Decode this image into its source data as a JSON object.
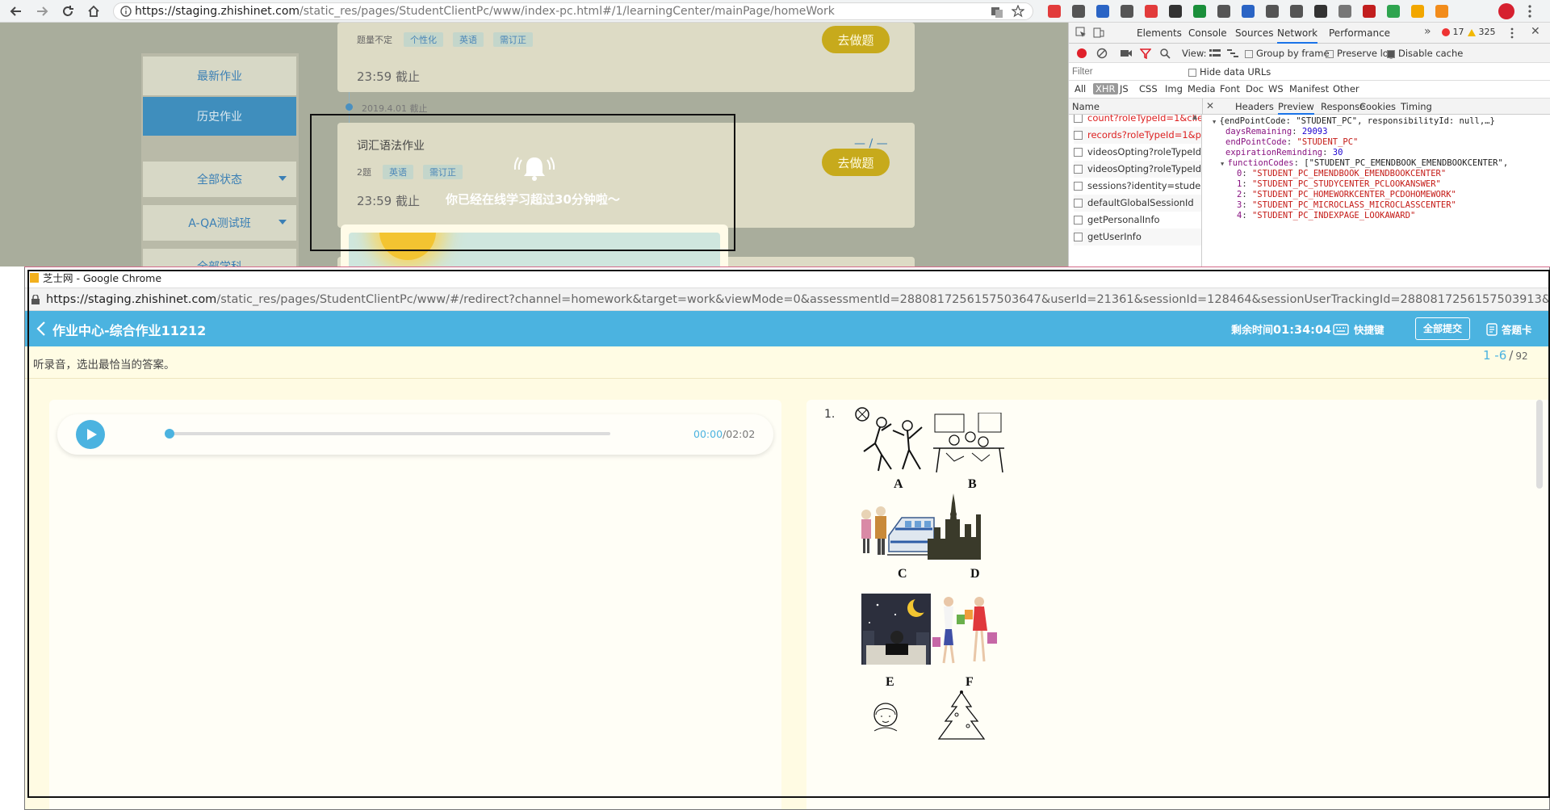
{
  "browser": {
    "url_base": "https://staging.zhishinet.com",
    "url_path": "/static_res/pages/StudentClientPc/www/index-pc.html#/1/learningCenter/mainPage/homeWork"
  },
  "bg_page": {
    "menu": {
      "latest": "最新作业",
      "history": "历史作业",
      "all_status": "全部状态",
      "class": "A-QA测试班",
      "all_subject": "全部学科"
    },
    "card1": {
      "count": "题量不定",
      "tags": [
        "个性化",
        "英语",
        "需订正"
      ],
      "deadline": "23:59 截止",
      "go_button": "去做题"
    },
    "date_label": "2019.4.01 截止",
    "card2": {
      "title": "词汇语法作业",
      "count": "2题",
      "tags": [
        "英语",
        "需订正"
      ],
      "score": "— / —",
      "deadline": "23:59 截止",
      "go_button": "去做题"
    },
    "notice": "你已经在线学习超过30分钟啦～"
  },
  "devtools": {
    "tabs": [
      "Elements",
      "Console",
      "Sources",
      "Network",
      "Performance"
    ],
    "active_tab": "Network",
    "errors": "17",
    "warnings": "325",
    "toolbar": {
      "view_label": "View:",
      "group_by_frame": "Group by frame",
      "preserve_log": "Preserve log",
      "disable_cache": "Disable cache"
    },
    "filter_placeholder": "Filter",
    "hide_data_urls": "Hide data URLs",
    "type_filters": [
      "All",
      "XHR",
      "JS",
      "CSS",
      "Img",
      "Media",
      "Font",
      "Doc",
      "WS",
      "Manifest",
      "Other"
    ],
    "active_type": "XHR",
    "name_header": "Name",
    "requests": [
      {
        "name": "count?roleTypeId=1&clientTy...",
        "error": true
      },
      {
        "name": "records?roleTypeId=1&pageN...",
        "error": true
      },
      {
        "name": "videosOpting?roleTypeId=1&s...",
        "error": false
      },
      {
        "name": "videosOpting?roleTypeId=1&s...",
        "error": false
      },
      {
        "name": "sessions?identity=student",
        "error": false
      },
      {
        "name": "defaultGlobalSessionId",
        "error": false
      },
      {
        "name": "getPersonalInfo",
        "error": false
      },
      {
        "name": "getUserInfo",
        "error": false
      }
    ],
    "detail_tabs": [
      "Headers",
      "Preview",
      "Response",
      "Cookies",
      "Timing"
    ],
    "active_detail": "Preview",
    "preview": [
      {
        "key": "",
        "text": "{endPointCode: \"STUDENT_PC\", responsibilityId: null,…}"
      },
      {
        "key": "daysRemaining",
        "text": "29093",
        "kind": "num"
      },
      {
        "key": "endPointCode",
        "text": "\"STUDENT_PC\"",
        "kind": "str"
      },
      {
        "key": "expirationReminding",
        "text": "30",
        "kind": "num"
      },
      {
        "key": "functionCodes",
        "text": "[\"STUDENT_PC_EMENDBOOK_EMENDBOOKCENTER\",",
        "kind": "arr"
      },
      {
        "key": "0",
        "text": "\"STUDENT_PC_EMENDBOOK_EMENDBOOKCENTER\"",
        "kind": "str"
      },
      {
        "key": "1",
        "text": "\"STUDENT_PC_STUDYCENTER_PCLOOKANSWER\"",
        "kind": "str"
      },
      {
        "key": "2",
        "text": "\"STUDENT_PC_HOMEWORKCENTER_PCDOHOMEWORK\"",
        "kind": "str"
      },
      {
        "key": "3",
        "text": "\"STUDENT_PC_MICROCLASS_MICROCLASSCENTER\"",
        "kind": "str"
      },
      {
        "key": "4",
        "text": "\"STUDENT_PC_INDEXPAGE_LOOKAWARD\"",
        "kind": "str"
      }
    ]
  },
  "popup": {
    "window_title": "芝士网 - Google Chrome",
    "url_base": "https://staging.zhishinet.com",
    "url_path": "/static_res/pages/StudentClientPc/www/#/redirect?channel=homework&target=work&viewMode=0&assessmentId=2880817256157503647&userId=21361&sessionId=128464&sessionUserTrackingId=2880817256157503913&subjectId=1&A...",
    "header_title": "作业中心-综合作业11212",
    "time_label": "剩余时间",
    "time_value": "01:34:04",
    "shortcut": "快捷键",
    "submit_all": "全部提交",
    "answer_card": "答题卡",
    "instruction": "听录音，选出最恰当的答案。",
    "progress_current": "1 -6",
    "progress_sep": "/",
    "progress_total": "92",
    "audio_current": "00:00",
    "audio_total": "/02:02",
    "audio_progress": 0,
    "question_number": "1.",
    "options": [
      "A",
      "B",
      "C",
      "D",
      "E",
      "F"
    ]
  },
  "colors": {
    "accent": "#4bb3e0",
    "gold": "#c7aa1c",
    "cream": "#fffbe3"
  }
}
